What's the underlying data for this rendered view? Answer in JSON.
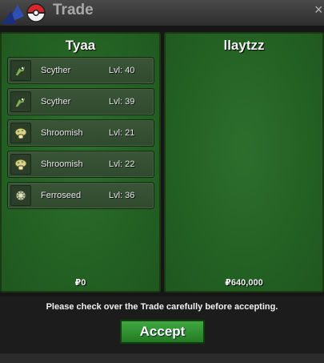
{
  "window": {
    "title": "Trade",
    "close_glyph": "×"
  },
  "left_panel": {
    "player": "Tyaa",
    "money": "₽0",
    "items": [
      {
        "name": "Scyther",
        "level": "Lvl: 40",
        "icon": "scyther-icon"
      },
      {
        "name": "Scyther",
        "level": "Lvl: 39",
        "icon": "scyther-icon"
      },
      {
        "name": "Shroomish",
        "level": "Lvl: 21",
        "icon": "shroomish-icon"
      },
      {
        "name": "Shroomish",
        "level": "Lvl: 22",
        "icon": "shroomish-icon"
      },
      {
        "name": "Ferroseed",
        "level": "Lvl: 36",
        "icon": "ferroseed-icon"
      }
    ]
  },
  "right_panel": {
    "player": "llaytzz",
    "money": "₽640,000"
  },
  "notice": "Please check over the Trade carefully before accepting.",
  "accept_label": "Accept"
}
